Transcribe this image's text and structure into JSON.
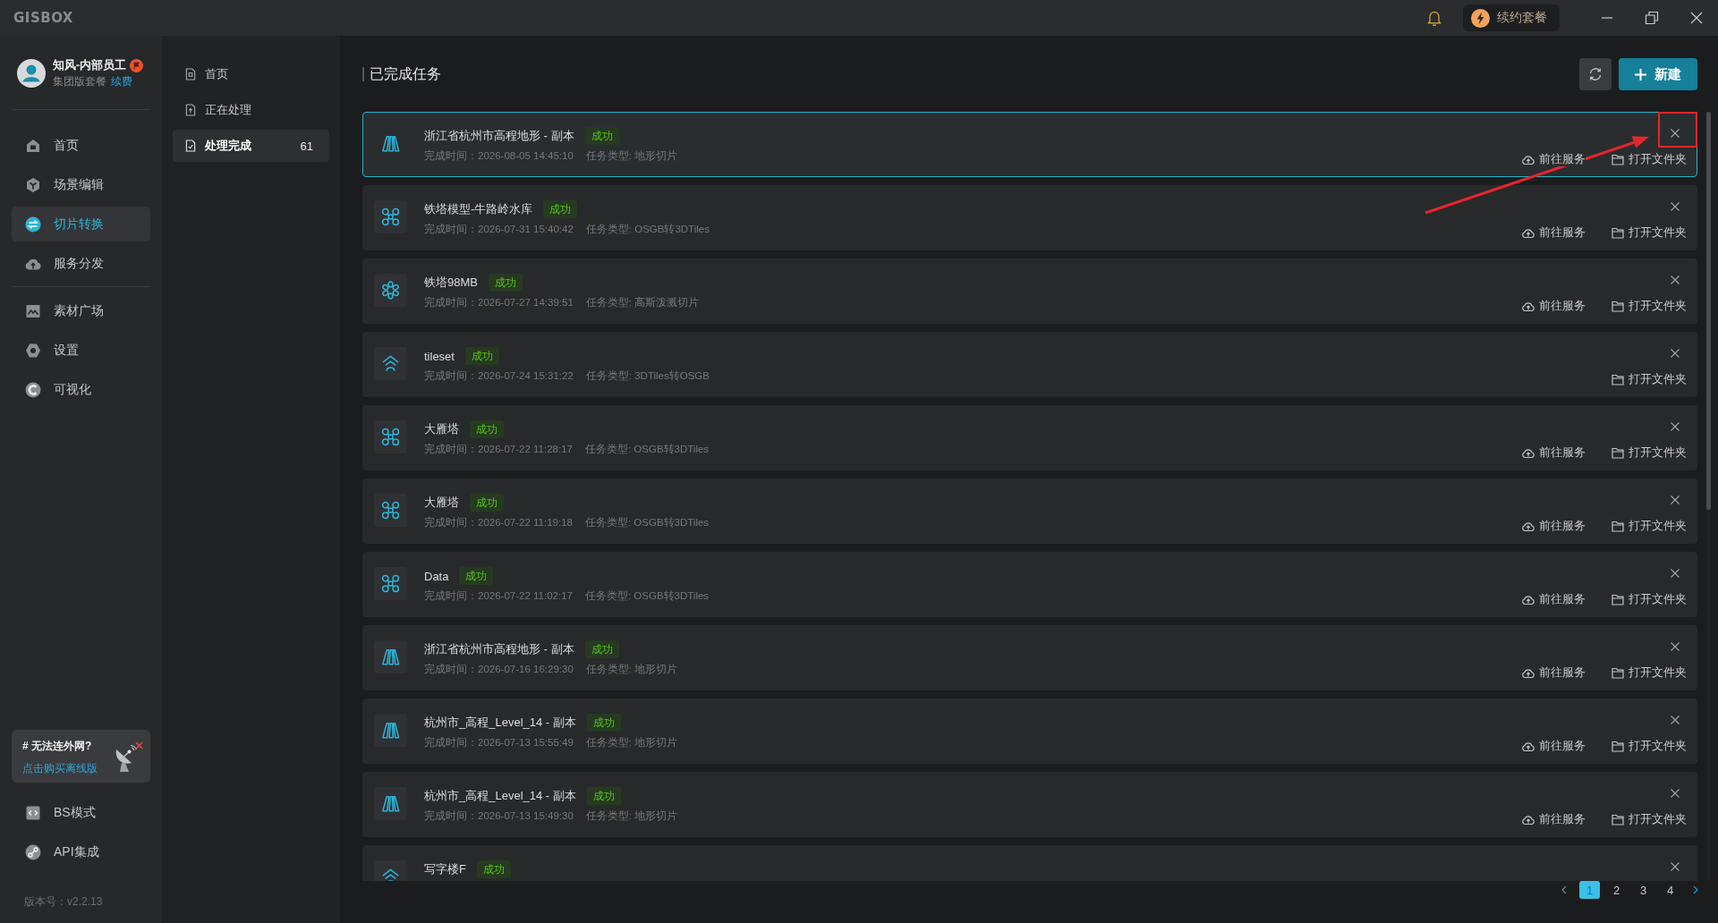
{
  "titlebar": {
    "logo": "GISBOX",
    "renew_button": "续约套餐"
  },
  "user": {
    "name": "知风-内部员工",
    "plan": "集团版套餐",
    "renew_link": "续费"
  },
  "nav": [
    {
      "items": [
        {
          "label": "首页",
          "selected": false
        },
        {
          "label": "场景编辑",
          "selected": false
        },
        {
          "label": "切片转换",
          "selected": true
        },
        {
          "label": "服务分发",
          "selected": false
        }
      ]
    },
    {
      "items": [
        {
          "label": "素材广场",
          "selected": false
        },
        {
          "label": "设置",
          "selected": false
        },
        {
          "label": "可视化",
          "selected": false
        }
      ]
    }
  ],
  "promo": {
    "title": "# 无法连外网?",
    "link": "点击购买离线版"
  },
  "bottom_nav": [
    {
      "label": "BS模式"
    },
    {
      "label": "API集成"
    }
  ],
  "version": "版本号：v2.2.13",
  "subnav": [
    {
      "label": "首页",
      "selected": false
    },
    {
      "label": "正在处理",
      "selected": false
    },
    {
      "label": "处理完成",
      "selected": true,
      "count": "61"
    }
  ],
  "main": {
    "title": "已完成任务",
    "new_button": "新建",
    "tasks": [
      {
        "kind": "terrain",
        "title": "浙江省杭州市高程地形 - 副本",
        "status": "成功",
        "completed_at": "完成时间：2026-08-05 14:45:10",
        "task_type": "任务类型: 地形切片",
        "actions": [
          {
            "kind": "service",
            "label": "前往服务"
          },
          {
            "kind": "folder",
            "label": "打开文件夹"
          }
        ],
        "selected": true,
        "close_highlighted": true
      },
      {
        "kind": "model",
        "title": "铁塔模型-牛路岭水库",
        "status": "成功",
        "completed_at": "完成时间：2026-07-31 15:40:42",
        "task_type": "任务类型: OSGB转3DTiles",
        "actions": [
          {
            "kind": "service",
            "label": "前往服务"
          },
          {
            "kind": "folder",
            "label": "打开文件夹"
          }
        ],
        "selected": false,
        "close_highlighted": false
      },
      {
        "kind": "splat",
        "title": "铁塔98MB",
        "status": "成功",
        "completed_at": "完成时间：2026-07-27 14:39:51",
        "task_type": "任务类型: 高斯泼溅切片",
        "actions": [
          {
            "kind": "service",
            "label": "前往服务"
          },
          {
            "kind": "folder",
            "label": "打开文件夹"
          }
        ],
        "selected": false,
        "close_highlighted": false
      },
      {
        "kind": "tiles",
        "title": "tileset",
        "status": "成功",
        "completed_at": "完成时间：2026-07-24 15:31:22",
        "task_type": "任务类型: 3DTiles转OSGB",
        "actions": [
          {
            "kind": "folder",
            "label": "打开文件夹"
          }
        ],
        "selected": false,
        "close_highlighted": false
      },
      {
        "kind": "model",
        "title": "大雁塔",
        "status": "成功",
        "completed_at": "完成时间：2026-07-22 11:28:17",
        "task_type": "任务类型: OSGB转3DTiles",
        "actions": [
          {
            "kind": "service",
            "label": "前往服务"
          },
          {
            "kind": "folder",
            "label": "打开文件夹"
          }
        ],
        "selected": false,
        "close_highlighted": false
      },
      {
        "kind": "model",
        "title": "大雁塔",
        "status": "成功",
        "completed_at": "完成时间：2026-07-22 11:19:18",
        "task_type": "任务类型: OSGB转3DTiles",
        "actions": [
          {
            "kind": "service",
            "label": "前往服务"
          },
          {
            "kind": "folder",
            "label": "打开文件夹"
          }
        ],
        "selected": false,
        "close_highlighted": false
      },
      {
        "kind": "model",
        "title": "Data",
        "status": "成功",
        "completed_at": "完成时间：2026-07-22 11:02:17",
        "task_type": "任务类型: OSGB转3DTiles",
        "actions": [
          {
            "kind": "service",
            "label": "前往服务"
          },
          {
            "kind": "folder",
            "label": "打开文件夹"
          }
        ],
        "selected": false,
        "close_highlighted": false
      },
      {
        "kind": "terrain",
        "title": "浙江省杭州市高程地形 - 副本",
        "status": "成功",
        "completed_at": "完成时间：2026-07-16 16:29:30",
        "task_type": "任务类型: 地形切片",
        "actions": [
          {
            "kind": "service",
            "label": "前往服务"
          },
          {
            "kind": "folder",
            "label": "打开文件夹"
          }
        ],
        "selected": false,
        "close_highlighted": false
      },
      {
        "kind": "terrain",
        "title": "杭州市_高程_Level_14 - 副本",
        "status": "成功",
        "completed_at": "完成时间：2026-07-13 15:55:49",
        "task_type": "任务类型: 地形切片",
        "actions": [
          {
            "kind": "service",
            "label": "前往服务"
          },
          {
            "kind": "folder",
            "label": "打开文件夹"
          }
        ],
        "selected": false,
        "close_highlighted": false
      },
      {
        "kind": "terrain",
        "title": "杭州市_高程_Level_14 - 副本",
        "status": "成功",
        "completed_at": "完成时间：2026-07-13 15:49:30",
        "task_type": "任务类型: 地形切片",
        "actions": [
          {
            "kind": "service",
            "label": "前往服务"
          },
          {
            "kind": "folder",
            "label": "打开文件夹"
          }
        ],
        "selected": false,
        "close_highlighted": false
      },
      {
        "kind": "tiles",
        "title": "写字楼F",
        "status": "成功",
        "selected": false,
        "close_highlighted": false
      }
    ],
    "pagination": [
      {
        "label": "1",
        "selected": true
      },
      {
        "label": "2",
        "selected": false
      },
      {
        "label": "3",
        "selected": false
      },
      {
        "label": "4",
        "selected": false
      }
    ]
  }
}
